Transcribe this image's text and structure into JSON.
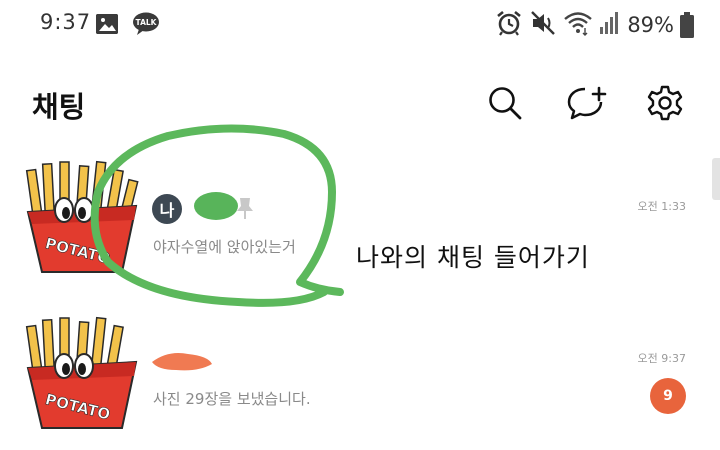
{
  "status_bar": {
    "time": "9:37",
    "battery_percent": "89%",
    "talk_icon_label": "TALK",
    "icons": [
      "gallery-icon",
      "talk-icon",
      "alarm-icon",
      "mute-icon",
      "wifi-icon",
      "signal-icon",
      "battery-icon"
    ]
  },
  "header": {
    "title": "채팅",
    "icons": [
      "search-icon",
      "new-chat-icon",
      "settings-icon"
    ]
  },
  "chats": [
    {
      "me_badge": "나",
      "preview": "야자수열에 앉아있는거",
      "time": "오전 1:33",
      "pinned": true,
      "avatar_text": "POTATO"
    },
    {
      "preview": "사진 29장을 보냈습니다.",
      "time": "오전 9:37",
      "unread": "9",
      "avatar_text": "POTATO"
    }
  ],
  "annotation": {
    "text": "나와의 채팅 들어가기"
  },
  "colors": {
    "accent_unread": "#e8643c",
    "annotation_green": "#5cb85c",
    "me_badge": "#3d4853"
  }
}
